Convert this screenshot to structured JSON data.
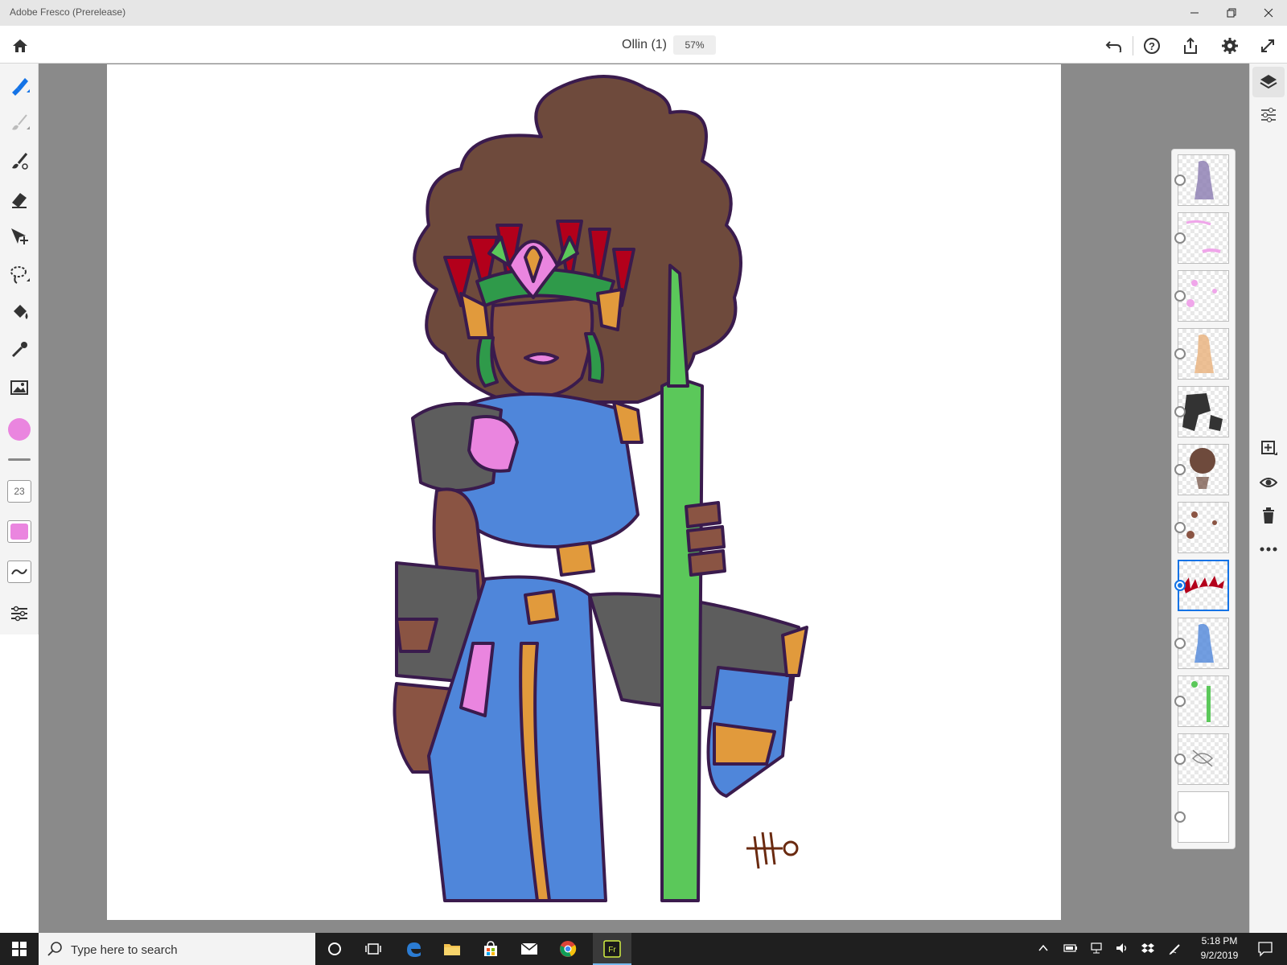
{
  "window": {
    "title": "Adobe Fresco (Prerelease)",
    "minimize_icon": "minimize-icon",
    "maximize_icon": "restore-icon",
    "close_icon": "close-icon"
  },
  "header": {
    "document_title": "Ollin (1)",
    "zoom": "57%",
    "icons": [
      "home-icon",
      "undo-icon",
      "help-icon",
      "share-icon",
      "settings-icon",
      "fullscreen-icon"
    ]
  },
  "left_toolbar": {
    "tools": [
      "pixel-brush-icon",
      "live-brush-icon",
      "vector-brush-icon",
      "eraser-icon",
      "move-transform-icon",
      "lasso-select-icon",
      "fill-icon",
      "eyedropper-icon",
      "place-image-icon"
    ],
    "current_color": "#ea85df",
    "brush_size": "23",
    "brush_color": "#ea85df"
  },
  "right_rail": {
    "icons": [
      "layers-icon",
      "layer-properties-icon",
      "add-layer-icon",
      "visibility-icon",
      "delete-layer-icon",
      "more-icon"
    ]
  },
  "layers": {
    "count": 12,
    "selected_index": 7
  },
  "colors": {
    "accent": "#1473e6",
    "hair": "#6e4a3c",
    "skin": "#8a5443",
    "armor": "#5d5d5d",
    "suit": "#4f86da",
    "gold": "#e19a3c",
    "staff": "#5bc85a",
    "outline": "#3a1b4d",
    "pink": "#ea85df",
    "feather": "#b3001b"
  },
  "taskbar": {
    "search_placeholder": "Type here to search",
    "time": "5:18 PM",
    "date": "9/2/2019"
  }
}
